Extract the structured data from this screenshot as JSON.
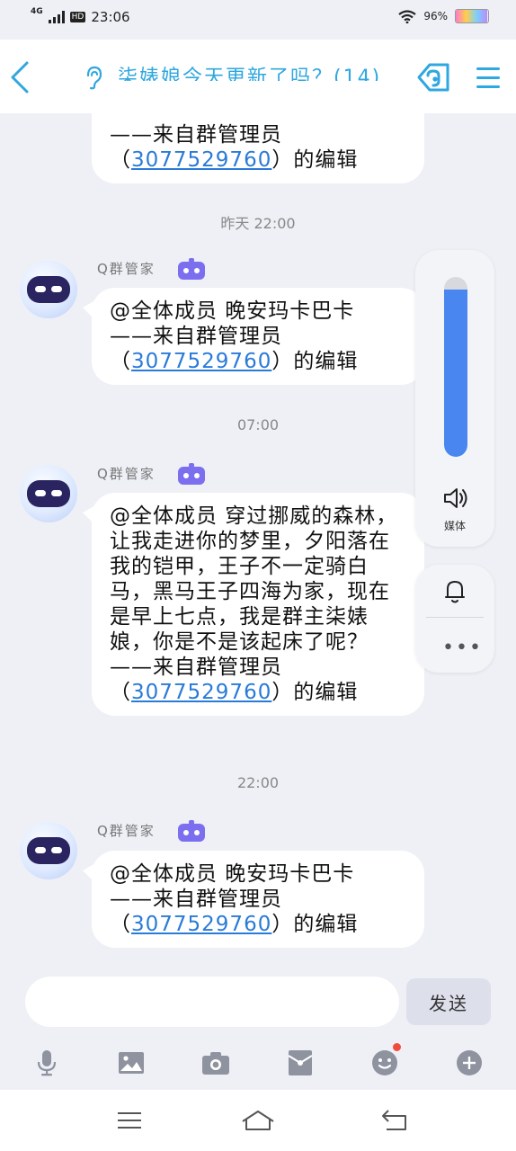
{
  "status_bar": {
    "network": "4G",
    "hd": "HD",
    "time": "23:06",
    "battery": "96%",
    "battery_level": 0.96
  },
  "header": {
    "title": "柒婊娘今天更新了吗？(14)"
  },
  "messages": [
    {
      "type": "partial",
      "line2": "——来自群管理员",
      "qq": "3077529760",
      "suffix": "）的编辑",
      "prefix": "（"
    },
    {
      "timestamp": "昨天 22:00",
      "sender": "Q群管家",
      "line1": "@全体成员 晚安玛卡巴卡",
      "line2": "——来自群管理员",
      "prefix": "（",
      "qq": "3077529760",
      "suffix": "）的编辑"
    },
    {
      "timestamp": "07:00",
      "sender": "Q群管家",
      "body": "@全体成员 穿过挪威的森林，让我走进你的梦里，夕阳落在我的铠甲，王子不一定骑白马，黑马王子四海为家，现在是早上七点，我是群主柒婊娘，你是不是该起床了呢？",
      "line2": "——来自群管理员",
      "prefix": "（",
      "qq": "3077529760",
      "suffix": "）的编辑"
    },
    {
      "timestamp": "22:00",
      "sender": "Q群管家",
      "line1": "@全体成员 晚安玛卡巴卡",
      "line2": "——来自群管理员",
      "prefix": "（",
      "qq": "3077529760",
      "suffix": "）的编辑"
    }
  ],
  "volume_panel": {
    "label": "媒体",
    "level": 0.93
  },
  "composer": {
    "placeholder": "",
    "send_label": "发送"
  },
  "toolbar": [
    "mic-icon",
    "image-icon",
    "camera-icon",
    "red-packet-icon",
    "emoji-icon",
    "plus-icon"
  ],
  "colors": {
    "accent": "#2fa7df",
    "link": "#2a7bd8",
    "volume": "#4a86ef",
    "notify_dot": "#f14c3a"
  }
}
